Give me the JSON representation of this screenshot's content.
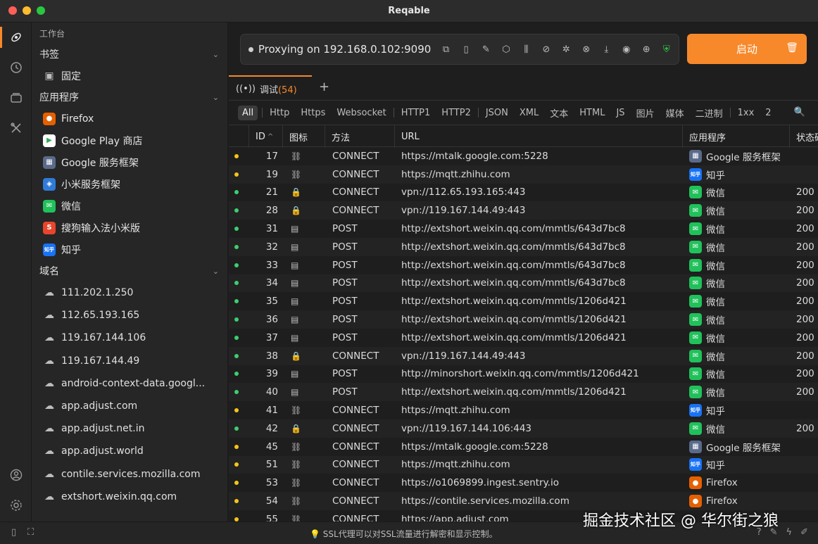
{
  "app": {
    "title": "Reqable"
  },
  "colors": {
    "accent": "#f7892b",
    "yellow_dot": "#f5c518",
    "green_dot": "#3ccf6e",
    "shield_green": "#2ecc40"
  },
  "activitybar": {
    "icons": [
      "network-icon",
      "history-icon",
      "collections-icon",
      "tools-icon"
    ],
    "bottom_icons": [
      "account-icon",
      "settings-icon"
    ]
  },
  "sidebar": {
    "header": "工作台",
    "bookmarks": {
      "label": "书签",
      "items": [
        {
          "label": "固定",
          "icon": "pin-folder-icon"
        }
      ]
    },
    "apps": {
      "label": "应用程序",
      "items": [
        {
          "label": "Firefox",
          "icon": "firefox-icon",
          "color": "#e66000",
          "glyph": "●"
        },
        {
          "label": "Google Play 商店",
          "icon": "google-play-icon",
          "color": "#ffffff",
          "glyph": "▶"
        },
        {
          "label": "Google 服务框架",
          "icon": "android-icon",
          "color": "#5a6a8a",
          "glyph": "▦"
        },
        {
          "label": "小米服务框架",
          "icon": "xiaomi-icon",
          "color": "#2f7bd9",
          "glyph": "◈"
        },
        {
          "label": "微信",
          "icon": "wechat-icon",
          "color": "#20c15a",
          "glyph": "✉"
        },
        {
          "label": "搜狗输入法小米版",
          "icon": "sogou-icon",
          "color": "#e8452c",
          "glyph": "S"
        },
        {
          "label": "知乎",
          "icon": "zhihu-icon",
          "color": "#1772f6",
          "glyph": "知乎"
        }
      ]
    },
    "domains": {
      "label": "域名",
      "items": [
        "111.202.1.250",
        "112.65.193.165",
        "119.167.144.106",
        "119.167.144.49",
        "android-context-data.googl...",
        "app.adjust.com",
        "app.adjust.net.in",
        "app.adjust.world",
        "contile.services.mozilla.com",
        "extshort.weixin.qq.com"
      ]
    }
  },
  "proxy": {
    "status_text": "Proxying on 192.168.0.102:9090",
    "toolbar_icons": [
      "copy-icon",
      "mobile-icon",
      "edit-icon",
      "ssl-lock-icon",
      "throttle-icon",
      "network-off-icon",
      "bug-icon",
      "block-icon",
      "download-icon",
      "breakpoint-icon",
      "globe-icon",
      "shield-check-icon"
    ],
    "start_label": "启动",
    "trash_icon": "trash-icon"
  },
  "tabs": [
    {
      "label": "调试",
      "count": "(54)"
    }
  ],
  "filters": {
    "all": "All",
    "groups": [
      [
        "Http",
        "Https",
        "Websocket"
      ],
      [
        "HTTP1",
        "HTTP2"
      ],
      [
        "JSON",
        "XML",
        "文本",
        "HTML",
        "JS",
        "图片",
        "媒体",
        "二进制"
      ],
      [
        "1xx",
        "2"
      ]
    ]
  },
  "table": {
    "headers": {
      "id": "ID",
      "icon": "图标",
      "method": "方法",
      "url": "URL",
      "app": "应用程序",
      "status": "状态码"
    },
    "rows": [
      {
        "dot": "yellow",
        "id": "17",
        "icon": "⛓",
        "method": "CONNECT",
        "url": "https://mtalk.google.com:5228",
        "app": "Google 服务框架",
        "app_icon": "android",
        "status": ""
      },
      {
        "dot": "yellow",
        "id": "19",
        "icon": "⛓",
        "method": "CONNECT",
        "url": "https://mqtt.zhihu.com",
        "app": "知乎",
        "app_icon": "zhihu",
        "status": ""
      },
      {
        "dot": "green",
        "id": "21",
        "icon": "🔒",
        "method": "CONNECT",
        "url": "vpn://112.65.193.165:443",
        "app": "微信",
        "app_icon": "wechat",
        "status": "200"
      },
      {
        "dot": "green",
        "id": "28",
        "icon": "🔒",
        "method": "CONNECT",
        "url": "vpn://119.167.144.49:443",
        "app": "微信",
        "app_icon": "wechat",
        "status": "200"
      },
      {
        "dot": "green",
        "id": "31",
        "icon": "▤",
        "method": "POST",
        "url": "http://extshort.weixin.qq.com/mmtls/643d7bc8",
        "app": "微信",
        "app_icon": "wechat",
        "status": "200"
      },
      {
        "dot": "green",
        "id": "32",
        "icon": "▤",
        "method": "POST",
        "url": "http://extshort.weixin.qq.com/mmtls/643d7bc8",
        "app": "微信",
        "app_icon": "wechat",
        "status": "200"
      },
      {
        "dot": "green",
        "id": "33",
        "icon": "▤",
        "method": "POST",
        "url": "http://extshort.weixin.qq.com/mmtls/643d7bc8",
        "app": "微信",
        "app_icon": "wechat",
        "status": "200"
      },
      {
        "dot": "green",
        "id": "34",
        "icon": "▤",
        "method": "POST",
        "url": "http://extshort.weixin.qq.com/mmtls/643d7bc8",
        "app": "微信",
        "app_icon": "wechat",
        "status": "200"
      },
      {
        "dot": "green",
        "id": "35",
        "icon": "▤",
        "method": "POST",
        "url": "http://extshort.weixin.qq.com/mmtls/1206d421",
        "app": "微信",
        "app_icon": "wechat",
        "status": "200"
      },
      {
        "dot": "green",
        "id": "36",
        "icon": "▤",
        "method": "POST",
        "url": "http://extshort.weixin.qq.com/mmtls/1206d421",
        "app": "微信",
        "app_icon": "wechat",
        "status": "200"
      },
      {
        "dot": "green",
        "id": "37",
        "icon": "▤",
        "method": "POST",
        "url": "http://extshort.weixin.qq.com/mmtls/1206d421",
        "app": "微信",
        "app_icon": "wechat",
        "status": "200"
      },
      {
        "dot": "green",
        "id": "38",
        "icon": "🔒",
        "method": "CONNECT",
        "url": "vpn://119.167.144.49:443",
        "app": "微信",
        "app_icon": "wechat",
        "status": "200"
      },
      {
        "dot": "green",
        "id": "39",
        "icon": "▤",
        "method": "POST",
        "url": "http://minorshort.weixin.qq.com/mmtls/1206d421",
        "app": "微信",
        "app_icon": "wechat",
        "status": "200"
      },
      {
        "dot": "green",
        "id": "40",
        "icon": "▤",
        "method": "POST",
        "url": "http://extshort.weixin.qq.com/mmtls/1206d421",
        "app": "微信",
        "app_icon": "wechat",
        "status": "200"
      },
      {
        "dot": "yellow",
        "id": "41",
        "icon": "⛓",
        "method": "CONNECT",
        "url": "https://mqtt.zhihu.com",
        "app": "知乎",
        "app_icon": "zhihu",
        "status": ""
      },
      {
        "dot": "green",
        "id": "42",
        "icon": "🔒",
        "method": "CONNECT",
        "url": "vpn://119.167.144.106:443",
        "app": "微信",
        "app_icon": "wechat",
        "status": "200"
      },
      {
        "dot": "yellow",
        "id": "45",
        "icon": "⛓",
        "method": "CONNECT",
        "url": "https://mtalk.google.com:5228",
        "app": "Google 服务框架",
        "app_icon": "android",
        "status": ""
      },
      {
        "dot": "yellow",
        "id": "51",
        "icon": "⛓",
        "method": "CONNECT",
        "url": "https://mqtt.zhihu.com",
        "app": "知乎",
        "app_icon": "zhihu",
        "status": ""
      },
      {
        "dot": "yellow",
        "id": "53",
        "icon": "⛓",
        "method": "CONNECT",
        "url": "https://o1069899.ingest.sentry.io",
        "app": "Firefox",
        "app_icon": "firefox",
        "status": ""
      },
      {
        "dot": "yellow",
        "id": "54",
        "icon": "⛓",
        "method": "CONNECT",
        "url": "https://contile.services.mozilla.com",
        "app": "Firefox",
        "app_icon": "firefox",
        "status": ""
      },
      {
        "dot": "yellow",
        "id": "55",
        "icon": "⛓",
        "method": "CONNECT",
        "url": "https://app.adjust.com",
        "app": "",
        "app_icon": "",
        "status": ""
      }
    ]
  },
  "statusbar": {
    "tip": "SSL代理可以对SSL流量进行解密和显示控制。",
    "left_icons": [
      "sidebar-toggle-icon",
      "fullscreen-icon"
    ],
    "right_icons": [
      "help-icon",
      "feedback-icon",
      "flash-icon",
      "edit-icon"
    ]
  },
  "watermark": "掘金技术社区 @ 华尔街之狼"
}
